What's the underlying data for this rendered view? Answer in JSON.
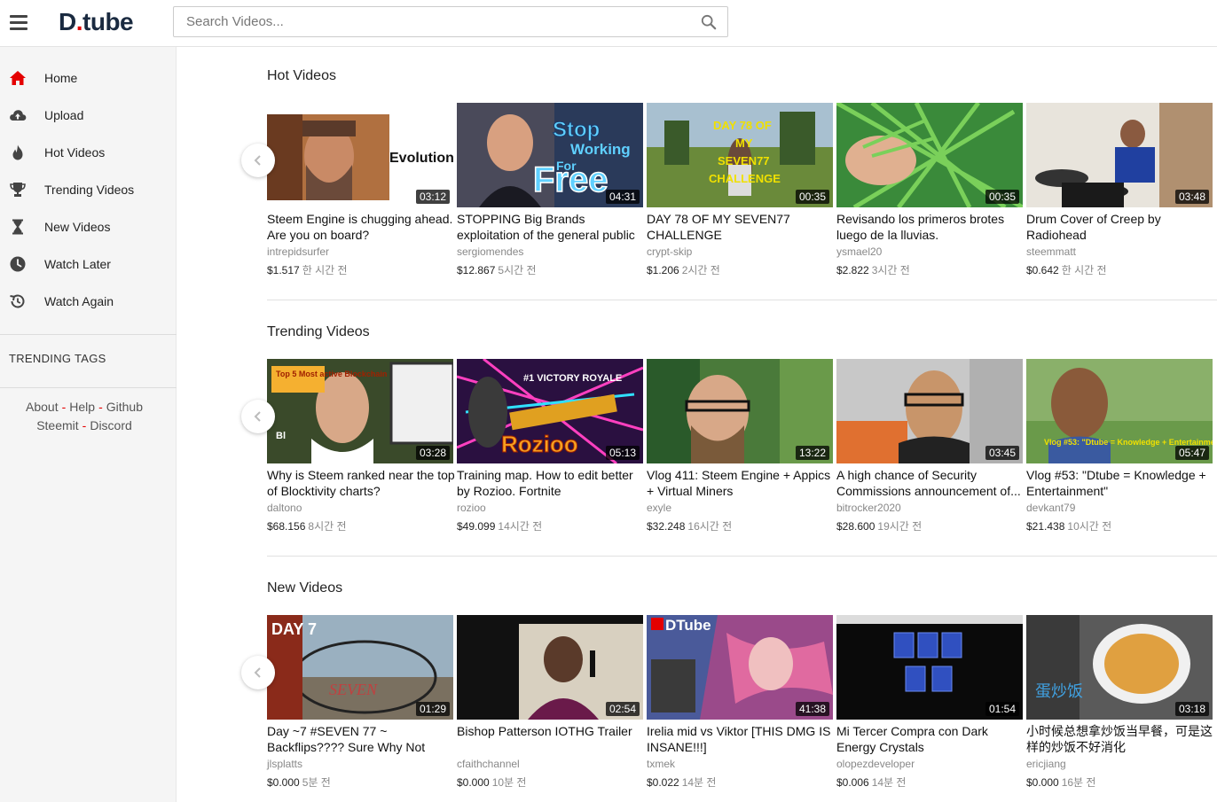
{
  "header": {
    "logo_main": "D",
    "logo_dot": ".",
    "logo_rest": "tube",
    "search_placeholder": "Search Videos..."
  },
  "sidebar": {
    "items": [
      {
        "label": "Home",
        "icon": "home-icon",
        "active": true
      },
      {
        "label": "Upload",
        "icon": "cloud-upload-icon"
      },
      {
        "label": "Hot Videos",
        "icon": "flame-icon"
      },
      {
        "label": "Trending Videos",
        "icon": "trophy-icon"
      },
      {
        "label": "New Videos",
        "icon": "hourglass-icon"
      },
      {
        "label": "Watch Later",
        "icon": "clock-icon"
      },
      {
        "label": "Watch Again",
        "icon": "history-icon"
      }
    ],
    "trending_tags_label": "TRENDING TAGS",
    "footer": {
      "about": "About",
      "help": "Help",
      "github": "Github",
      "steemit": "Steemit",
      "discord": "Discord",
      "separator": "-"
    }
  },
  "sections": [
    {
      "title": "Hot Videos",
      "videos": [
        {
          "title": "Steem Engine is chugging ahead. Are you on board?",
          "author": "intrepidsurfer",
          "payout": "$1.517",
          "ago": "한 시간 전",
          "duration": "03:12",
          "overlay": "Evolution"
        },
        {
          "title": "STOPPING Big Brands exploitation of the general public",
          "author": "sergiomendes",
          "payout": "$12.867",
          "ago": "5시간 전",
          "duration": "04:31",
          "overlay": "Stop Working For Free"
        },
        {
          "title": "DAY 78 OF MY SEVEN77 CHALLENGE",
          "author": "crypt-skip",
          "payout": "$1.206",
          "ago": "2시간 전",
          "duration": "00:35",
          "overlay": "DAY 78 OF MY SEVEN77 CHALLENGE"
        },
        {
          "title": "Revisando los primeros brotes luego de la lluvias.",
          "author": "ysmael20",
          "payout": "$2.822",
          "ago": "3시간 전",
          "duration": "00:35",
          "overlay": ""
        },
        {
          "title": "Drum Cover of Creep by Radiohead",
          "author": "steemmatt",
          "payout": "$0.642",
          "ago": "한 시간 전",
          "duration": "03:48",
          "overlay": ""
        }
      ]
    },
    {
      "title": "Trending Videos",
      "videos": [
        {
          "title": "Why is Steem ranked near the top of Blocktivity charts?",
          "author": "daltono",
          "payout": "$68.156",
          "ago": "8시간 전",
          "duration": "03:28",
          "overlay": "Top 5 Most active Blockchain"
        },
        {
          "title": "Training map. How to edit better by Rozioo. Fortnite",
          "author": "rozioo",
          "payout": "$49.099",
          "ago": "14시간 전",
          "duration": "05:13",
          "overlay": "Rozioo"
        },
        {
          "title": "Vlog 411: Steem Engine + Appics + Virtual Miners",
          "author": "exyle",
          "payout": "$32.248",
          "ago": "16시간 전",
          "duration": "13:22",
          "overlay": ""
        },
        {
          "title": "A high chance of Security Commissions announcement of...",
          "author": "bitrocker2020",
          "payout": "$28.600",
          "ago": "19시간 전",
          "duration": "03:45",
          "overlay": ""
        },
        {
          "title": "Vlog #53: \"Dtube = Knowledge + Entertainment\"",
          "author": "devkant79",
          "payout": "$21.438",
          "ago": "10시간 전",
          "duration": "05:47",
          "overlay": "Vlog #53: \"Dtube = Knowledge + Entertainment\""
        }
      ]
    },
    {
      "title": "New Videos",
      "videos": [
        {
          "title": "Day ~7 #SEVEN 77 ~ Backflips???? Sure Why Not",
          "author": "jlsplatts",
          "payout": "$0.000",
          "ago": "5분 전",
          "duration": "01:29",
          "overlay": "DAY 7"
        },
        {
          "title": "Bishop Patterson IOTHG Trailer",
          "author": "cfaithchannel",
          "payout": "$0.000",
          "ago": "10분 전",
          "duration": "02:54",
          "overlay": ""
        },
        {
          "title": "Irelia mid vs Viktor [THIS DMG IS INSANE!!!]",
          "author": "txmek",
          "payout": "$0.022",
          "ago": "14분 전",
          "duration": "41:38",
          "overlay": "DTube"
        },
        {
          "title": "Mi Tercer Compra con Dark Energy Crystals",
          "author": "olopezdeveloper",
          "payout": "$0.006",
          "ago": "14분 전",
          "duration": "01:54",
          "overlay": ""
        },
        {
          "title": "小时候总想拿炒饭当早餐，可是这样的炒饭不好消化",
          "author": "ericjiang",
          "payout": "$0.000",
          "ago": "16분 전",
          "duration": "03:18",
          "overlay": "蛋炒饭"
        }
      ]
    }
  ],
  "colors": {
    "brand_red": "#e40000",
    "logo_navy": "#1a2a40",
    "sidebar_bg": "#f5f5f5"
  }
}
